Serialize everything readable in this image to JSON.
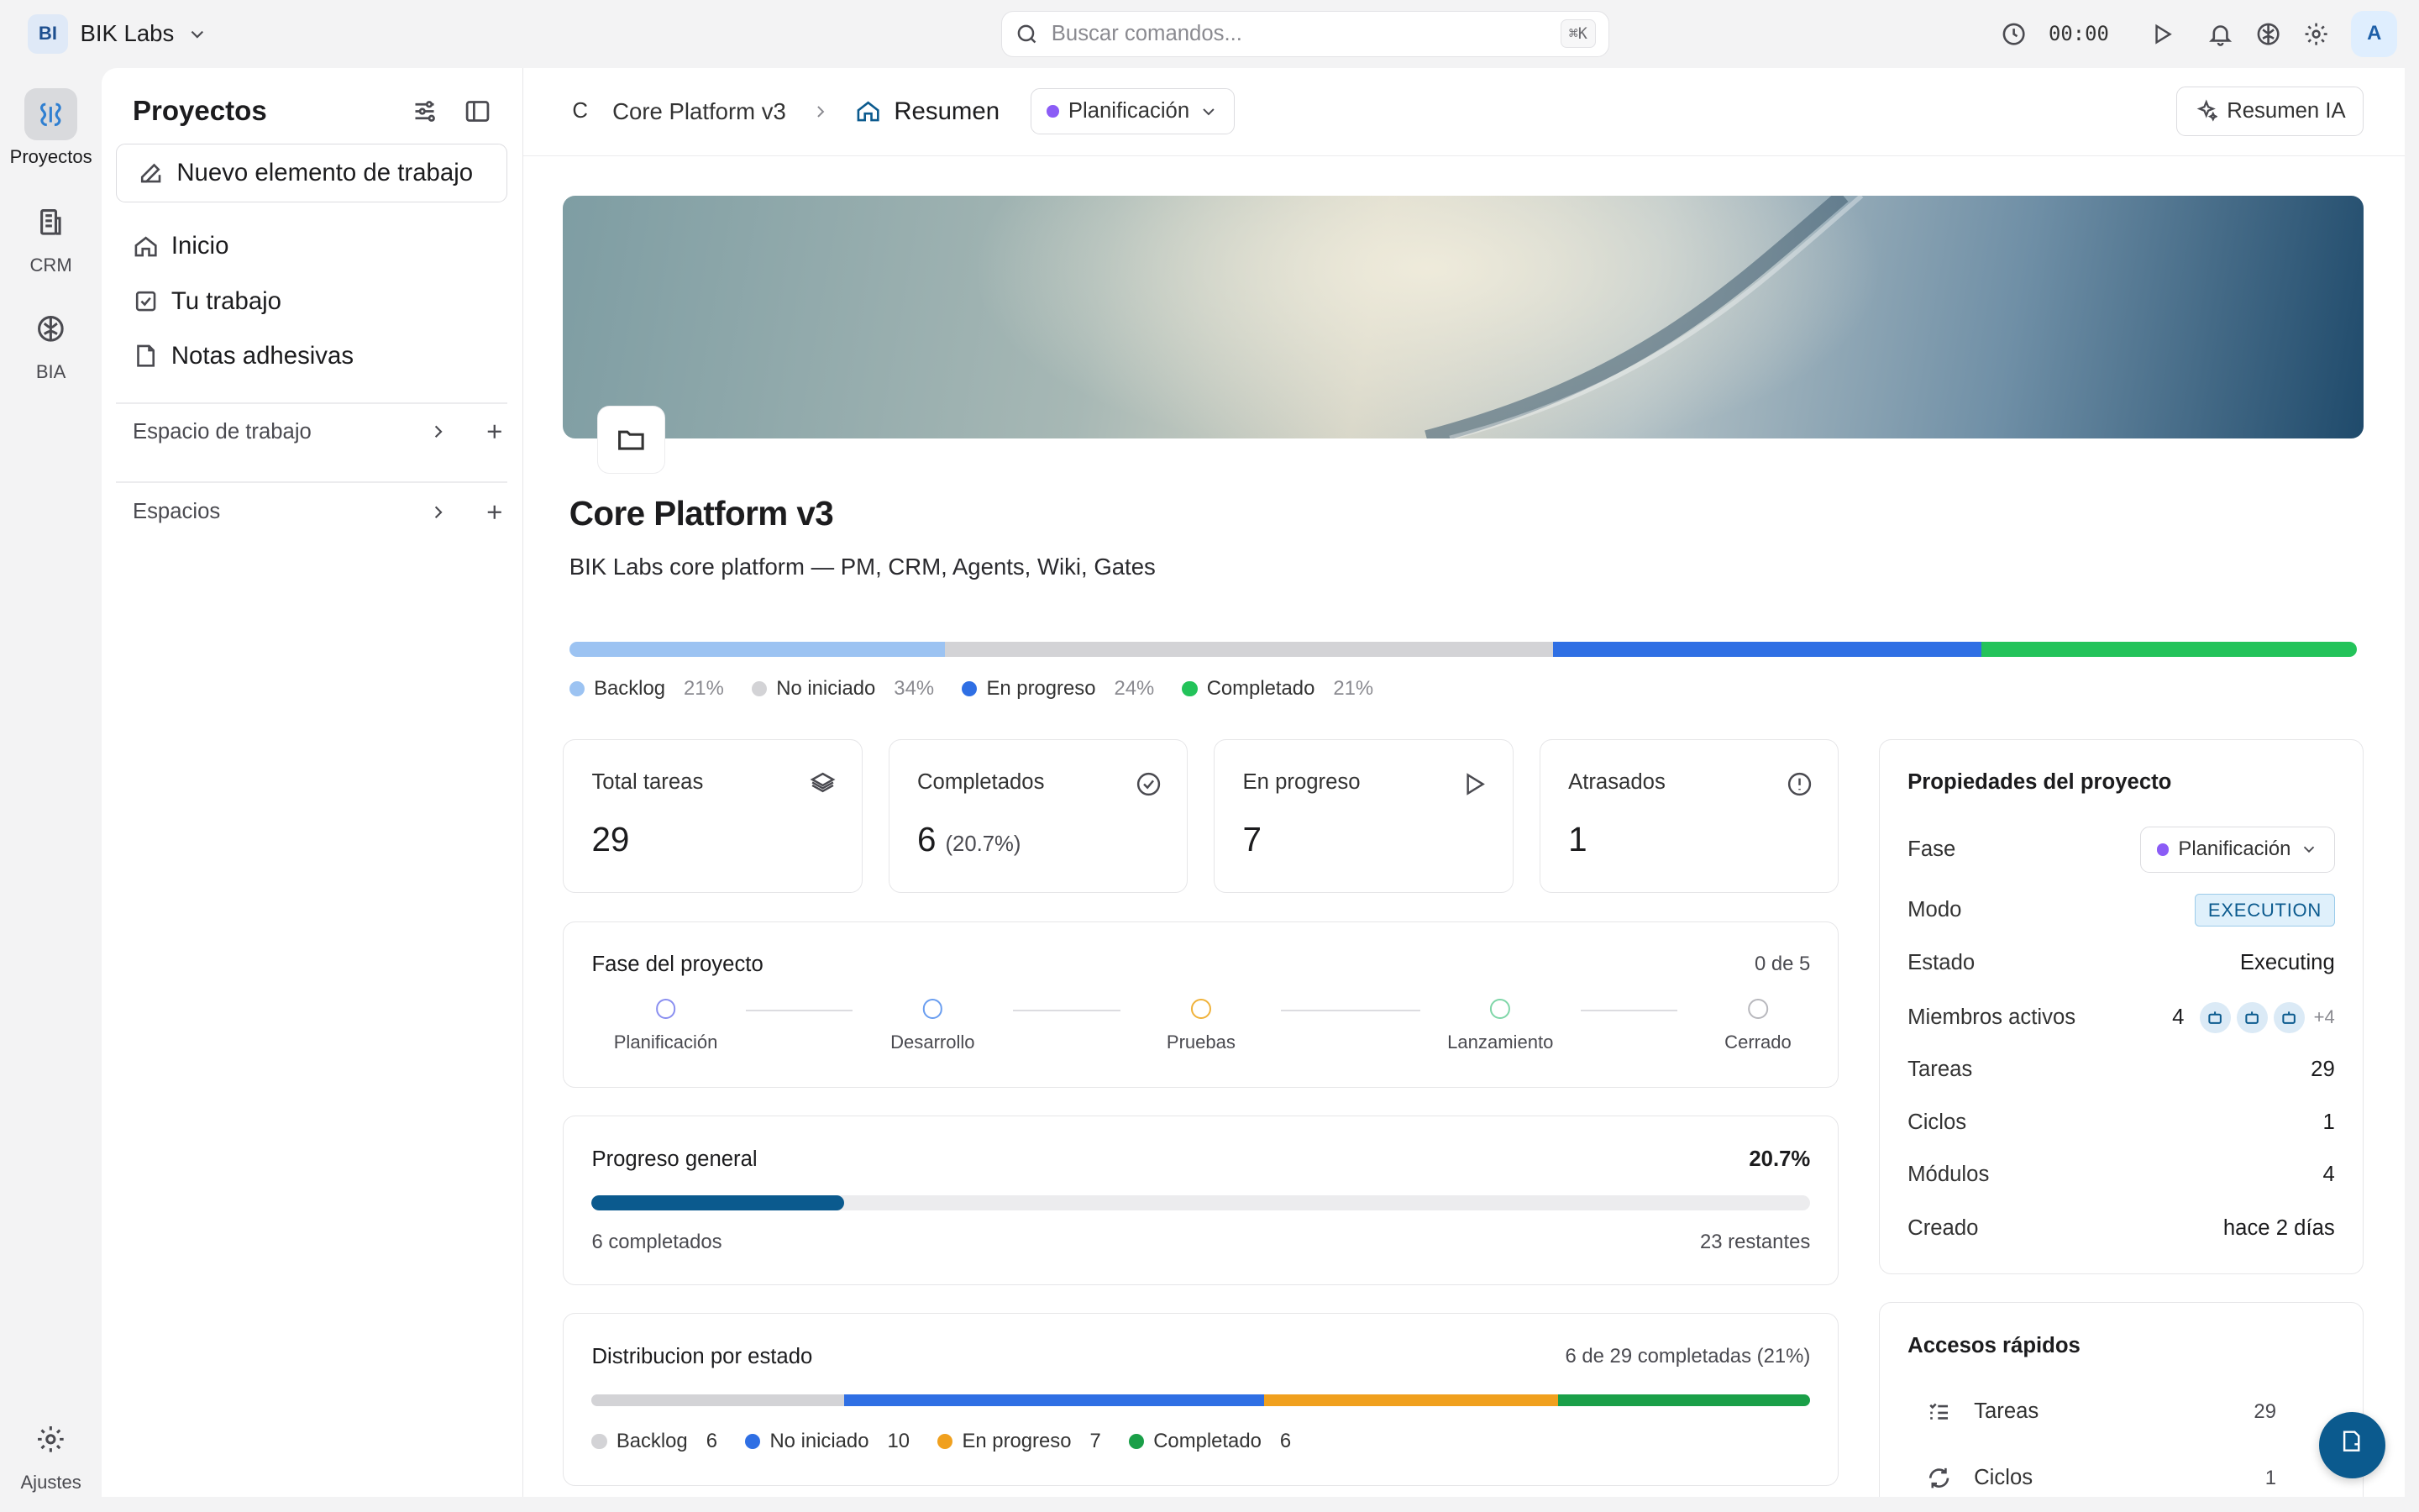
{
  "workspace": {
    "badge": "BI",
    "name": "BIK Labs"
  },
  "search": {
    "placeholder": "Buscar comandos...",
    "shortcut": "⌘K"
  },
  "timer": "00:00",
  "user": {
    "initial": "A"
  },
  "rail": {
    "items": [
      {
        "label": "Proyectos",
        "icon": "projects-icon"
      },
      {
        "label": "CRM",
        "icon": "crm-icon"
      },
      {
        "label": "BIA",
        "icon": "brain-icon"
      }
    ],
    "settings_label": "Ajustes"
  },
  "sidebar": {
    "title": "Proyectos",
    "new_item": "Nuevo elemento de trabajo",
    "nav": [
      {
        "label": "Inicio",
        "icon": "home-icon"
      },
      {
        "label": "Tu trabajo",
        "icon": "check-square-icon"
      },
      {
        "label": "Notas adhesivas",
        "icon": "note-icon"
      }
    ],
    "sections": [
      {
        "label": "Espacio de trabajo"
      },
      {
        "label": "Espacios"
      }
    ]
  },
  "header": {
    "project_initial": "C",
    "project_name": "Core Platform v3",
    "current": "Resumen",
    "phase": "Planificación",
    "ai_button": "Resumen IA"
  },
  "project": {
    "title": "Core Platform v3",
    "description": "BIK Labs core platform — PM, CRM, Agents, Wiki, Gates"
  },
  "status_breakdown": [
    {
      "label": "Backlog",
      "pct": "21%",
      "fraction": 0.21,
      "color": "#9cc3f2"
    },
    {
      "label": "No iniciado",
      "pct": "34%",
      "fraction": 0.34,
      "color": "#d3d3d6"
    },
    {
      "label": "En progreso",
      "pct": "24%",
      "fraction": 0.24,
      "color": "#2f6fe4"
    },
    {
      "label": "Completado",
      "pct": "21%",
      "fraction": 0.21,
      "color": "#23c35a"
    }
  ],
  "stats": [
    {
      "label": "Total tareas",
      "value": "29",
      "sub": "",
      "icon": "layers-icon"
    },
    {
      "label": "Completados",
      "value": "6",
      "sub": "(20.7%)",
      "icon": "check-circle-icon"
    },
    {
      "label": "En progreso",
      "value": "7",
      "sub": "",
      "icon": "play-icon"
    },
    {
      "label": "Atrasados",
      "value": "1",
      "sub": "",
      "icon": "alert-circle-icon"
    }
  ],
  "phases": {
    "title": "Fase del proyecto",
    "count": "0 de 5",
    "steps": [
      {
        "label": "Planificación",
        "color": "#8a8ff0"
      },
      {
        "label": "Desarrollo",
        "color": "#6a9ef0"
      },
      {
        "label": "Pruebas",
        "color": "#f0b23a"
      },
      {
        "label": "Lanzamiento",
        "color": "#7fd6a8"
      },
      {
        "label": "Cerrado",
        "color": "#b8b8bd"
      }
    ]
  },
  "progress": {
    "title": "Progreso general",
    "percent": "20.7%",
    "fraction": 0.207,
    "completed": "6 completados",
    "remaining": "23 restantes"
  },
  "distribution": {
    "title": "Distribucion por estado",
    "summary": "6 de 29 completadas (21%)",
    "items": [
      {
        "label": "Backlog",
        "count": "6",
        "value": 6,
        "color": "#d3d3d6"
      },
      {
        "label": "No iniciado",
        "count": "10",
        "value": 10,
        "color": "#2f6fe4"
      },
      {
        "label": "En progreso",
        "count": "7",
        "value": 7,
        "color": "#f0a01e"
      },
      {
        "label": "Completado",
        "count": "6",
        "value": 6,
        "color": "#1a9f48"
      }
    ]
  },
  "properties": {
    "title": "Propiedades del proyecto",
    "rows": {
      "fase": {
        "k": "Fase",
        "v": "Planificación"
      },
      "modo": {
        "k": "Modo",
        "v": "EXECUTION"
      },
      "estado": {
        "k": "Estado",
        "v": "Executing"
      },
      "miembros": {
        "k": "Miembros activos",
        "v": "4",
        "more": "+4"
      },
      "tareas": {
        "k": "Tareas",
        "v": "29"
      },
      "ciclos": {
        "k": "Ciclos",
        "v": "1"
      },
      "modulos": {
        "k": "Módulos",
        "v": "4"
      },
      "creado": {
        "k": "Creado",
        "v": "hace 2 días"
      }
    }
  },
  "quick_access": {
    "title": "Accesos rápidos",
    "items": [
      {
        "label": "Tareas",
        "count": "29",
        "icon": "task-list-icon"
      },
      {
        "label": "Ciclos",
        "count": "1",
        "icon": "cycle-icon"
      }
    ]
  },
  "colors": {
    "accent": "#0b5a8e",
    "phase_dot": "#8b5cf6"
  }
}
